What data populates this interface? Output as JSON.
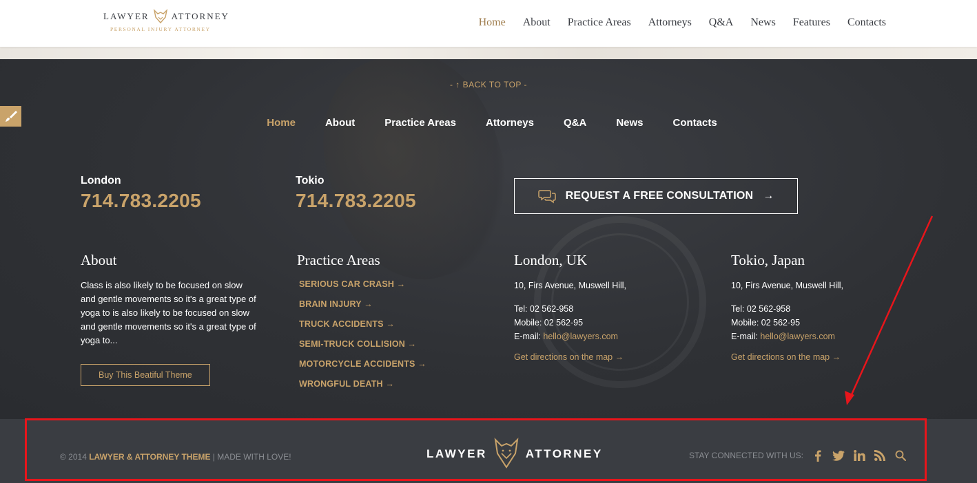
{
  "header": {
    "logo_left": "LAWYER",
    "logo_right": "ATTORNEY",
    "logo_tagline": "PERSONAL INJURY ATTORNEY",
    "nav": [
      {
        "label": "Home",
        "active": true
      },
      {
        "label": "About"
      },
      {
        "label": "Practice Areas"
      },
      {
        "label": "Attorneys"
      },
      {
        "label": "Q&A"
      },
      {
        "label": "News"
      },
      {
        "label": "Features"
      },
      {
        "label": "Contacts"
      }
    ]
  },
  "footer": {
    "back_to_top": "- ↑ BACK TO TOP -",
    "nav": [
      {
        "label": "Home",
        "active": true
      },
      {
        "label": "About"
      },
      {
        "label": "Practice Areas"
      },
      {
        "label": "Attorneys"
      },
      {
        "label": "Q&A"
      },
      {
        "label": "News"
      },
      {
        "label": "Contacts"
      }
    ],
    "phones": [
      {
        "city": "London",
        "number": "714.783.2205"
      },
      {
        "city": "Tokio",
        "number": "714.783.2205"
      }
    ],
    "consultation_label": "REQUEST A FREE CONSULTATION",
    "consultation_arrow": "→",
    "about": {
      "title": "About",
      "text": "Class is also likely to be focused on slow and gentle movements so it's a great type of yoga to is also likely to be focused on slow and gentle movements so it's a great type of yoga to...",
      "button": "Buy This Beatiful Theme"
    },
    "practice_areas": {
      "title": "Practice Areas",
      "items": [
        "SERIOUS CAR CRASH →",
        "BRAIN INJURY →",
        "TRUCK ACCIDENTS →",
        "SEMI-TRUCK COLLISION →",
        "MOTORCYCLE ACCIDENTS →",
        "WRONGFUL DEATH →"
      ]
    },
    "offices": [
      {
        "title": "London, UK",
        "address": "10, Firs Avenue, Muswell Hill,",
        "tel": "Tel: 02 562-958",
        "mobile": "Mobile: 02 562-95",
        "email_label": "E-mail: ",
        "email": "hello@lawyers.com",
        "directions": "Get directions on the map →"
      },
      {
        "title": "Tokio, Japan",
        "address": "10, Firs Avenue, Muswell Hill,",
        "tel": "Tel: 02 562-958",
        "mobile": "Mobile: 02 562-95",
        "email_label": "E-mail: ",
        "email": "hello@lawyers.com",
        "directions": "Get directions on the map →"
      }
    ]
  },
  "bottom_bar": {
    "copyright_prefix": "© 2014 ",
    "copyright_brand": "LAWYER & ATTORNEY THEME",
    "copyright_suffix": " | MADE WITH LOVE!",
    "logo_left": "LAWYER",
    "logo_right": "ATTORNEY",
    "stay_connected": "STAY CONNECTED WITH US:",
    "social_icons": [
      "facebook-icon",
      "twitter-icon",
      "linkedin-icon",
      "rss-icon",
      "search-icon"
    ]
  },
  "colors": {
    "accent_gold": "#c9a36a",
    "dark_bg": "#2f3135",
    "bottom_bar_bg": "#3a3d42",
    "annotation_red": "#e8151b"
  }
}
